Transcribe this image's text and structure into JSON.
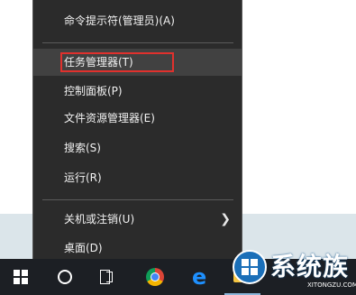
{
  "menu": {
    "items": [
      {
        "label": "命令提示符(管理员)(A)"
      },
      {
        "label": "任务管理器(T)"
      },
      {
        "label": "控制面板(P)"
      },
      {
        "label": "文件资源管理器(E)"
      },
      {
        "label": "搜索(S)"
      },
      {
        "label": "运行(R)"
      },
      {
        "label": "关机或注销(U)"
      },
      {
        "label": "桌面(D)"
      }
    ],
    "highlighted_color": "#e0312d"
  },
  "taskbar": {
    "icons": [
      "windows-start-icon",
      "cortana-icon",
      "task-view-icon",
      "chrome-icon",
      "edge-icon",
      "file-explorer-icon"
    ]
  },
  "watermark": {
    "text": "系统族",
    "subtext": "XITONGZU.COM"
  }
}
